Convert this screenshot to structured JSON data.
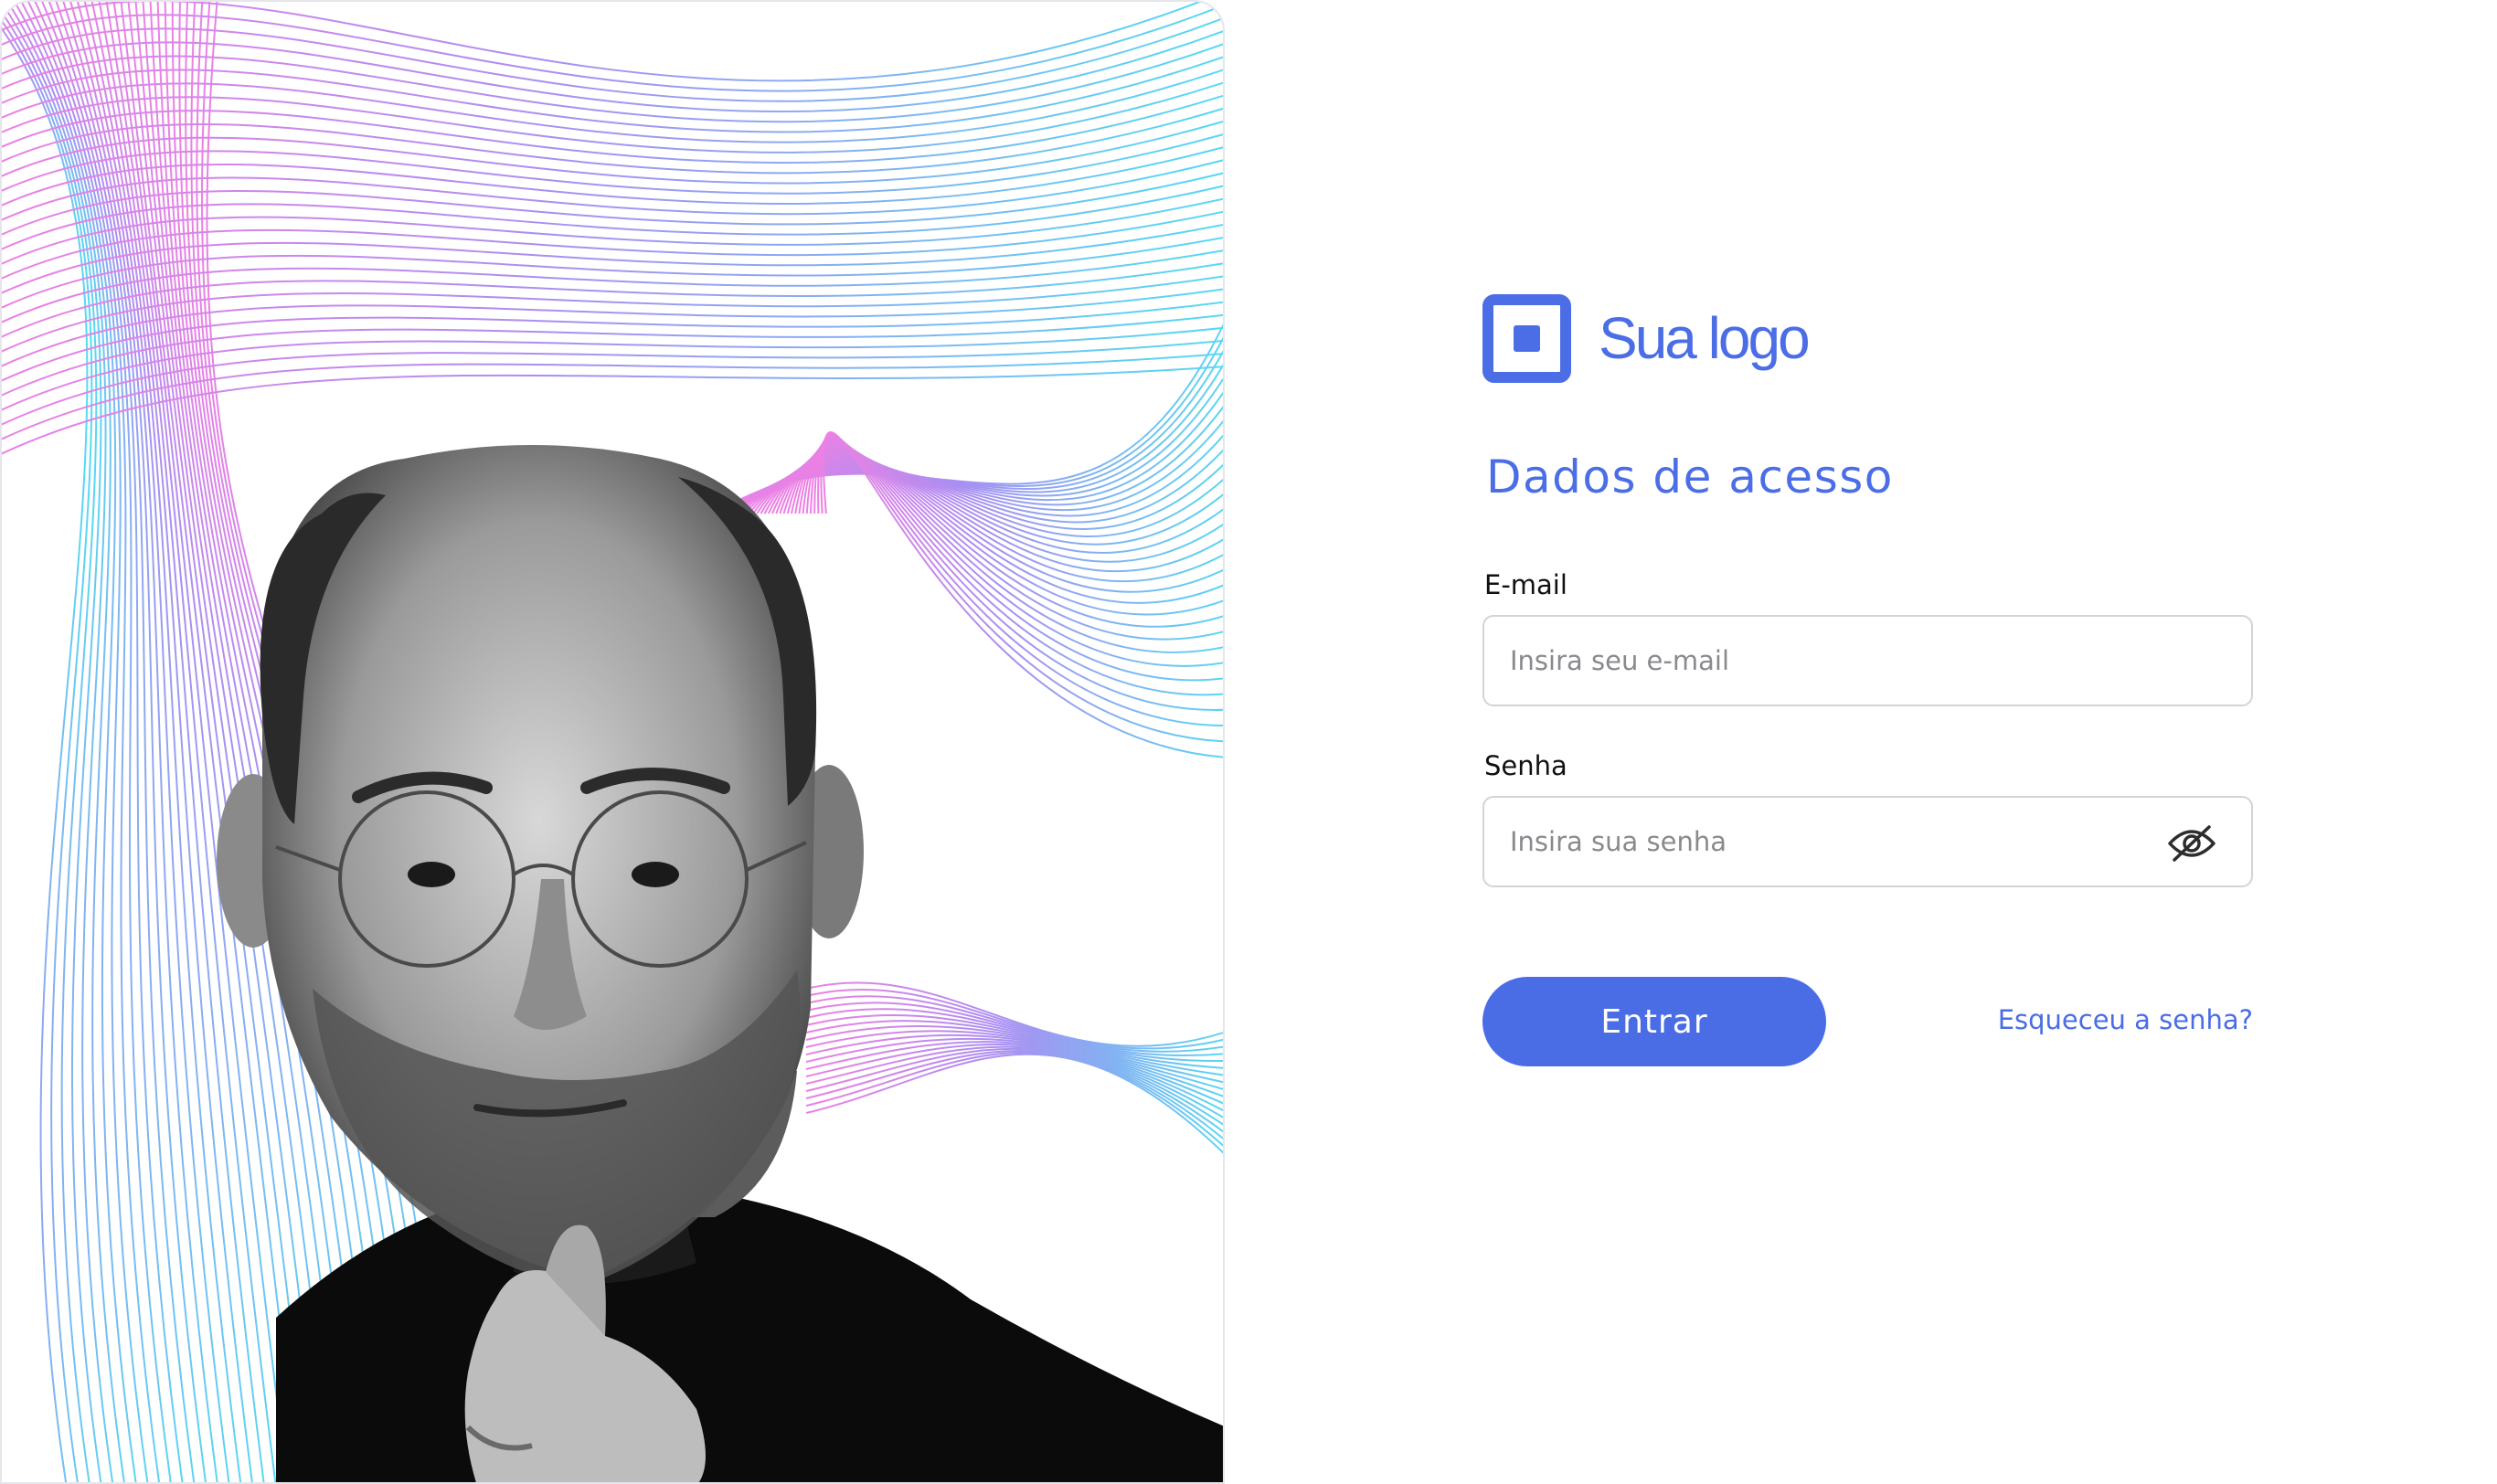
{
  "brand": {
    "logo_text": "Sua logo",
    "color": "#4b6ee6"
  },
  "hero": {
    "image_alt": "Portrait of a man with glasses",
    "wave_colors": [
      "#ea6be0",
      "#9b7cf0",
      "#36d6f0"
    ]
  },
  "login": {
    "title": "Dados de acesso",
    "email": {
      "label": "E-mail",
      "placeholder": "Insira seu e-mail",
      "value": ""
    },
    "password": {
      "label": "Senha",
      "placeholder": "Insira sua senha",
      "value": "",
      "toggle_icon": "eye-off-icon"
    },
    "submit_label": "Entrar",
    "forgot_label": "Esqueceu a senha?"
  },
  "colors": {
    "accent": "#4a6de6",
    "input_border": "#d4d4d8",
    "label_text": "#111111",
    "placeholder_text": "#8a8a8e"
  }
}
